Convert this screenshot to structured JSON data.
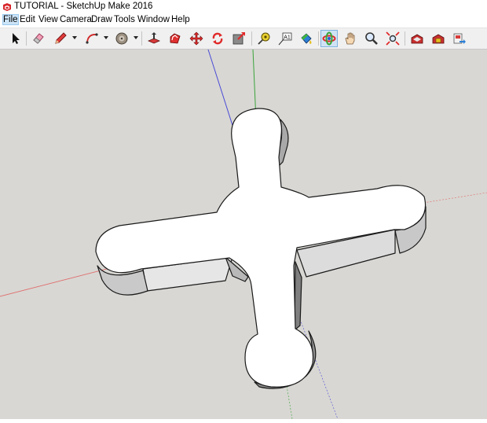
{
  "window": {
    "title": "TUTORIAL - SketchUp Make 2016",
    "app_icon": "sketchup-logo-icon"
  },
  "menu": [
    "File",
    "Edit",
    "View",
    "Camera",
    "Draw",
    "Tools",
    "Window",
    "Help"
  ],
  "toolbar": {
    "tools": [
      {
        "name": "select-icon",
        "active": false
      },
      {
        "name": "eraser-icon",
        "active": false
      },
      {
        "name": "pencil-line-icon",
        "active": false,
        "dropdown": true
      },
      {
        "name": "arc-icon",
        "active": false,
        "dropdown": true
      },
      {
        "name": "shapes-circle-icon",
        "active": false,
        "dropdown": true
      },
      {
        "name": "push-pull-icon",
        "active": false
      },
      {
        "name": "offset-icon",
        "active": false
      },
      {
        "name": "move-icon",
        "active": false
      },
      {
        "name": "rotate-icon",
        "active": false
      },
      {
        "name": "scale-icon",
        "active": false
      },
      {
        "name": "tape-measure-icon",
        "active": false
      },
      {
        "name": "text-icon",
        "active": false
      },
      {
        "name": "paint-bucket-icon",
        "active": false
      },
      {
        "name": "orbit-icon",
        "active": true
      },
      {
        "name": "pan-icon",
        "active": false
      },
      {
        "name": "zoom-icon",
        "active": false
      },
      {
        "name": "zoom-extents-icon",
        "active": false
      },
      {
        "name": "warehouse-icon",
        "active": false
      },
      {
        "name": "extension-warehouse-icon",
        "active": false
      },
      {
        "name": "send-to-layout-icon",
        "active": false
      }
    ]
  },
  "viewport": {
    "background": "#d8d7d3",
    "axes": {
      "red": "#e06a6a",
      "green": "#3aa33a",
      "blue": "#4a4ad8"
    },
    "model": "cross-shaped-extrusion"
  }
}
